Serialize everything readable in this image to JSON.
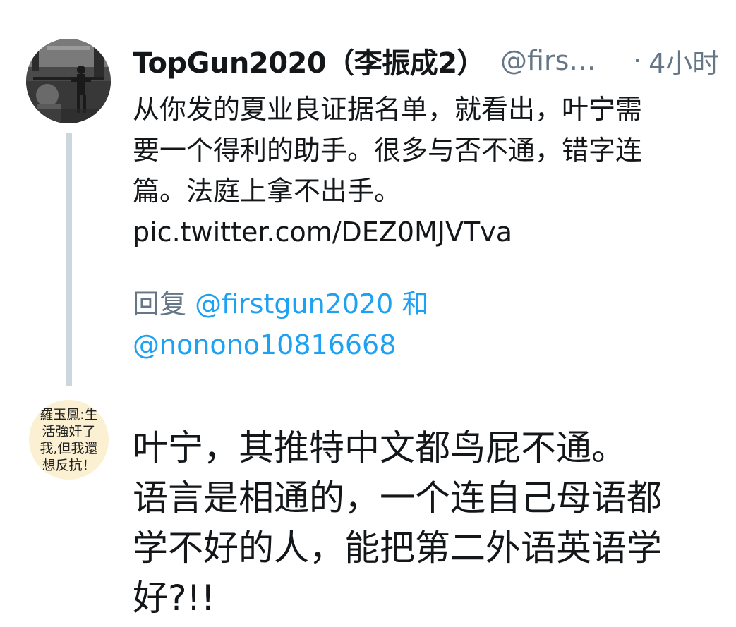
{
  "tweet1": {
    "display_name": "TopGun2020（李振成2）",
    "handle": "@first…",
    "separator": "·",
    "time": "4小时",
    "text_lines": [
      "从你发的夏业良证据名单，就看出，叶宁需",
      "要一个得利的助手。很多与否不通，错字连",
      "篇。法庭上拿不出手。"
    ],
    "link": "pic.twitter.com/DEZ0MJVTva",
    "reply_prefix": "回复",
    "reply_mention_1": "@firstgun2020",
    "reply_and": "和",
    "reply_mention_2": "@nonono10816668"
  },
  "tweet2": {
    "avatar_text": [
      "羅玉鳳:生",
      "活強奸了",
      "我,但我還",
      "想反抗！"
    ],
    "text_lines": [
      "叶宁，其推特中文都鸟屁不通。",
      "语言是相通的，一个连自己母语都",
      "学不好的人，能把第二外语英语学",
      "好?!!"
    ]
  },
  "colors": {
    "primary_text": "#14171a",
    "secondary_text": "#657786",
    "link_blue": "#1da1f2",
    "thread_line": "#ccd6dd",
    "avatar2_bg": "#fbf0d2"
  }
}
